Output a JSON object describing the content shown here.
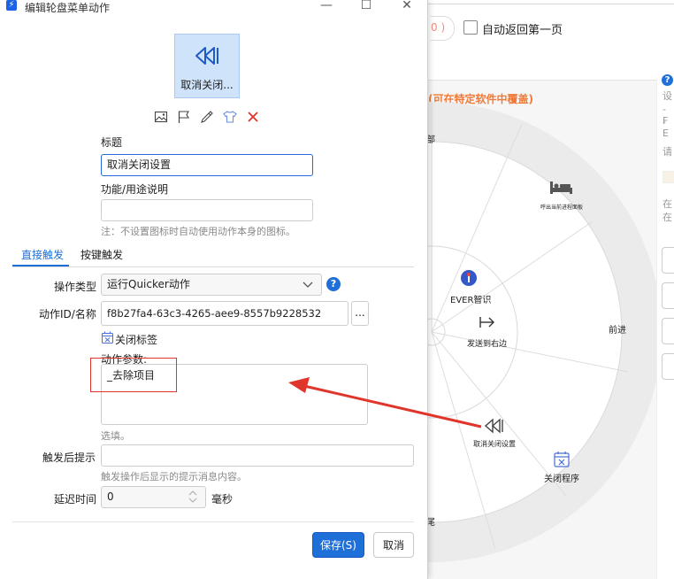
{
  "background": {
    "count_text": "0 )",
    "auto_return_label": "自动返回第一页",
    "notice": "(可在特定软件中覆盖)",
    "right_panel": {
      "fragments": [
        "设",
        "- F",
        "- E",
        "请",
        "在",
        "在"
      ]
    },
    "wheel": {
      "items": [
        {
          "label": "部"
        },
        {
          "label": "呼出当前进程面板",
          "icon": "bed-icon"
        },
        {
          "label": "EVER智识",
          "icon": "pin-icon"
        },
        {
          "label": "发送到右边",
          "icon": "arrow-right-bar-icon"
        },
        {
          "label": "前进"
        },
        {
          "label": "取消关闭设置",
          "icon": "rewind-icon"
        },
        {
          "label": "关闭程序",
          "icon": "calendar-x-icon"
        },
        {
          "label": "尾"
        }
      ]
    },
    "colors": {
      "notice": "#f07a3a",
      "arrow": "#e0352b"
    }
  },
  "dialog": {
    "window_title": "编辑轮盘菜单动作",
    "window_controls": {
      "minimize": "—",
      "maximize": "☐",
      "close": "✕"
    },
    "preview": {
      "label": "取消关闭...",
      "icon": "rewind-icon"
    },
    "tools": [
      {
        "name": "image-icon"
      },
      {
        "name": "flag-icon"
      },
      {
        "name": "eyedropper-icon"
      },
      {
        "name": "shirt-icon"
      },
      {
        "name": "delete-x-icon"
      }
    ],
    "fields": {
      "title_label": "标题",
      "title_value": "取消关闭设置",
      "desc_label": "功能/用途说明",
      "desc_value": "",
      "note": "注：不设置图标时自动使用动作本身的图标。"
    },
    "tabs": [
      {
        "label": "直接触发",
        "active": true
      },
      {
        "label": "按键触发",
        "active": false
      }
    ],
    "form": {
      "op_type_label": "操作类型",
      "op_type_value": "运行Quicker动作",
      "action_id_label": "动作ID/名称",
      "action_id_value": "f8b27fa4-63c3-4265-aee9-8557b9228532",
      "browse_button": "...",
      "action_name": "关闭标签",
      "params_label": "动作参数:",
      "params_value": "_去除项目",
      "params_hint": "选填。",
      "after_hint_label": "触发后提示",
      "after_hint_value": "",
      "after_hint_note": "触发操作后显示的提示消息内容。",
      "delay_label": "延迟时间",
      "delay_value": "0",
      "delay_unit": "毫秒"
    },
    "buttons": {
      "save": "保存(S)",
      "cancel": "取消"
    },
    "colors": {
      "accent": "#1e6fd8",
      "highlight": "#e0352b",
      "delete": "#e0352b"
    }
  }
}
